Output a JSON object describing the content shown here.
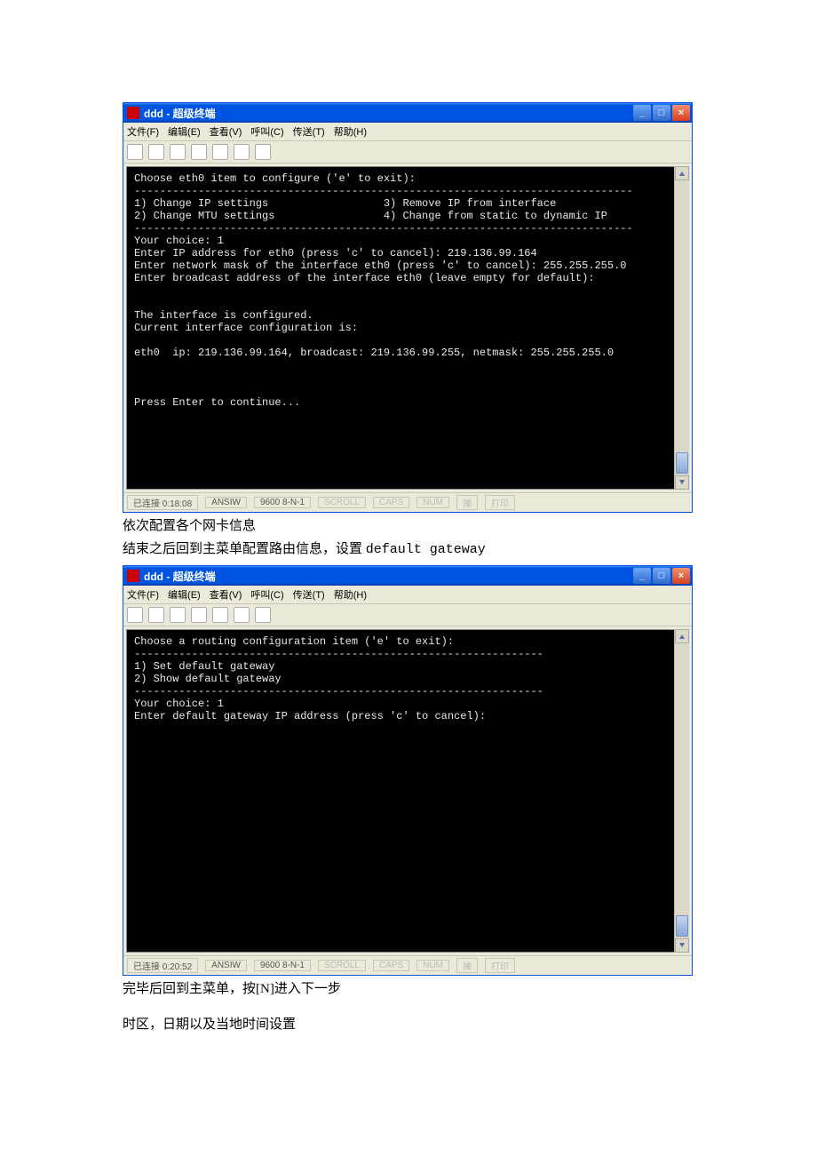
{
  "win1": {
    "title": "ddd - 超级终端",
    "controls": {
      "min": "_",
      "max": "□",
      "close": "×"
    },
    "menu": [
      "文件(F)",
      "编辑(E)",
      "查看(V)",
      "呼叫(C)",
      "传送(T)",
      "帮助(H)"
    ],
    "toolbar_icons": [
      "new-icon",
      "open-icon",
      "call-icon",
      "hangup-icon",
      "send-icon",
      "receive-icon",
      "properties-icon"
    ],
    "terminal": "Choose eth0 item to configure ('e' to exit):\n------------------------------------------------------------------------------\n1) Change IP settings                  3) Remove IP from interface\n2) Change MTU settings                 4) Change from static to dynamic IP\n------------------------------------------------------------------------------\nYour choice: 1\nEnter IP address for eth0 (press 'c' to cancel): 219.136.99.164\nEnter network mask of the interface eth0 (press 'c' to cancel): 255.255.255.0\nEnter broadcast address of the interface eth0 (leave empty for default):\n\n\nThe interface is configured.\nCurrent interface configuration is:\n\neth0  ip: 219.136.99.164, broadcast: 219.136.99.255, netmask: 255.255.255.0\n\n\n\nPress Enter to continue...\n\n\n\n\n",
    "status": {
      "conn": "已连接 0:18:08",
      "emul": "ANSIW",
      "baud": "9600 8-N-1",
      "labels": [
        "SCROLL",
        "CAPS",
        "NUM",
        "捕",
        "打印"
      ]
    }
  },
  "doc": {
    "p1": "依次配置各个网卡信息",
    "p2a": "结束之后回到主菜单配置路由信息，设置 ",
    "p2b": "default gateway",
    "p3": "完毕后回到主菜单，按[N]进入下一步",
    "p4": "时区，日期以及当地时间设置"
  },
  "win2": {
    "title": "ddd - 超级终端",
    "controls": {
      "min": "_",
      "max": "□",
      "close": "×"
    },
    "menu": [
      "文件(F)",
      "编辑(E)",
      "查看(V)",
      "呼叫(C)",
      "传送(T)",
      "帮助(H)"
    ],
    "toolbar_icons": [
      "new-icon",
      "open-icon",
      "call-icon",
      "hangup-icon",
      "send-icon",
      "receive-icon",
      "properties-icon"
    ],
    "terminal": "Choose a routing configuration item ('e' to exit):\n----------------------------------------------------------------\n1) Set default gateway\n2) Show default gateway\n----------------------------------------------------------------\nYour choice: 1\nEnter default gateway IP address (press 'c' to cancel):\n\n\n\n\n\n\n\n\n\n\n\n\n\n\n\n\n\n\n",
    "status": {
      "conn": "已连接 0:20:52",
      "emul": "ANSIW",
      "baud": "9600 8-N-1",
      "labels": [
        "SCROLL",
        "CAPS",
        "NUM",
        "捕",
        "打印"
      ]
    }
  }
}
